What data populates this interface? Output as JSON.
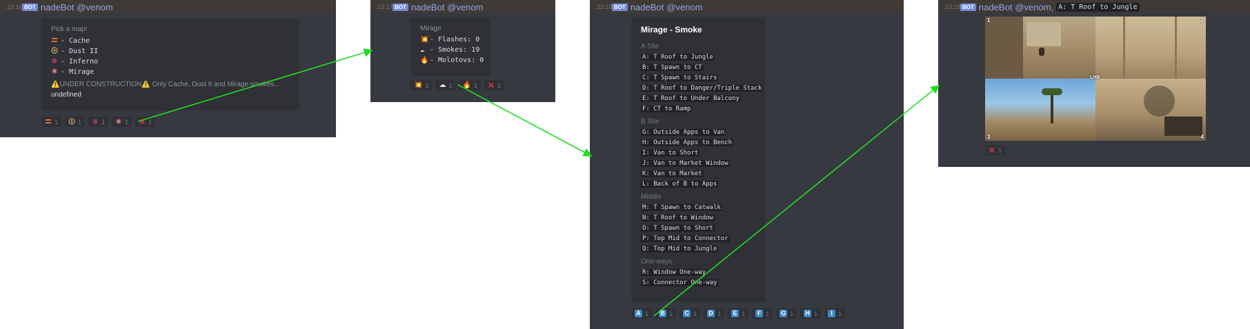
{
  "panels": [
    {
      "time": "23:16",
      "bot_tag": "BOT",
      "username": "nadeBot",
      "mention": "@venom",
      "embed": {
        "title": "Pick a map!",
        "items": [
          {
            "icon": "cache-icon",
            "label": "- Cache"
          },
          {
            "icon": "dust2-icon",
            "label": "- Dust II"
          },
          {
            "icon": "inferno-icon",
            "label": "- Inferno"
          },
          {
            "icon": "mirage-icon",
            "label": "- Mirage"
          }
        ],
        "warning": "⚠️UNDER CONSTRUCTION⚠️ Only Cache, Dust II and Mirage smokes...",
        "footer": "undefined"
      },
      "reactions": [
        {
          "icon": "cache-icon",
          "count": "1"
        },
        {
          "icon": "dust2-icon",
          "count": "1"
        },
        {
          "icon": "inferno-icon",
          "count": "1"
        },
        {
          "icon": "mirage-icon",
          "count": "1"
        },
        {
          "icon": "x-icon",
          "count": "1"
        }
      ]
    },
    {
      "time": "23:17",
      "bot_tag": "BOT",
      "username": "nadeBot",
      "mention": "@venom",
      "embed": {
        "title": "Mirage",
        "items": [
          {
            "icon": "flash-icon",
            "glyph": "💥",
            "label": "- Flashes: 0"
          },
          {
            "icon": "smoke-icon",
            "glyph": "☁",
            "label": "- Smokes: 19"
          },
          {
            "icon": "fire-icon",
            "glyph": "🔥",
            "label": "- Molotovs: 0"
          }
        ]
      },
      "reactions": [
        {
          "icon": "flash-icon",
          "glyph": "💥",
          "count": "1"
        },
        {
          "icon": "smoke-icon",
          "glyph": "☁",
          "count": "1"
        },
        {
          "icon": "fire-icon",
          "glyph": "🔥",
          "count": "1"
        },
        {
          "icon": "x-icon",
          "glyph": "✕",
          "count": "1"
        }
      ]
    },
    {
      "time": "23:18",
      "bot_tag": "BOT",
      "username": "nadeBot",
      "mention": "@venom",
      "embed": {
        "title": "Mirage - Smoke",
        "sections": [
          {
            "name": "A Site",
            "items": [
              "A: T Roof to Jungle",
              "B: T Spawn to CT",
              "C: T Spawn to Stairs",
              "D: T Roof to Danger/Triple Stack",
              "E: T Roof to Under Balcony",
              "F: CT to Ramp"
            ]
          },
          {
            "name": "B Site",
            "items": [
              "G: Outside Apps to Van",
              "H: Outside Apps to Bench",
              "I: Van to Short",
              "J: Van to Market Window",
              "K: Van to Market",
              "L: Back of B to Apps"
            ]
          },
          {
            "name": "Middle",
            "items": [
              "M: T Spawn to Catwalk",
              "N: T Roof to Window",
              "O: T Spawn to Short",
              "P: Top Mid to Connector",
              "Q: Top Mid to Jungle"
            ]
          },
          {
            "name": "One-ways",
            "items": [
              "R: Window One-way",
              "S: Connector One-way"
            ]
          }
        ]
      },
      "reactions": [
        {
          "letter": "A",
          "count": "1"
        },
        {
          "letter": "B",
          "count": "1"
        },
        {
          "letter": "C",
          "count": "1"
        },
        {
          "letter": "D",
          "count": "1"
        },
        {
          "letter": "E",
          "count": "1"
        },
        {
          "letter": "F",
          "count": "1"
        },
        {
          "letter": "G",
          "count": "1"
        },
        {
          "letter": "H",
          "count": "1"
        },
        {
          "letter": "I",
          "count": "1"
        }
      ]
    },
    {
      "time": "23:18",
      "bot_tag": "BOT",
      "username": "nadeBot",
      "mention": "@venom,",
      "inline_code": "A: T Roof to Jungle",
      "image_labels": [
        "1",
        "2",
        "3",
        "4"
      ],
      "overlay_text": "LHB",
      "reactions": [
        {
          "icon": "x-icon",
          "glyph": "✕",
          "count": "1"
        }
      ]
    }
  ],
  "colors": {
    "panel_bg": "#36393f",
    "embed_bg": "#2f3136",
    "username": "#8fa6e8",
    "arrow": "#22dd22",
    "letter_badge": "#3b88c3",
    "x_mark": "#dd2e44"
  }
}
